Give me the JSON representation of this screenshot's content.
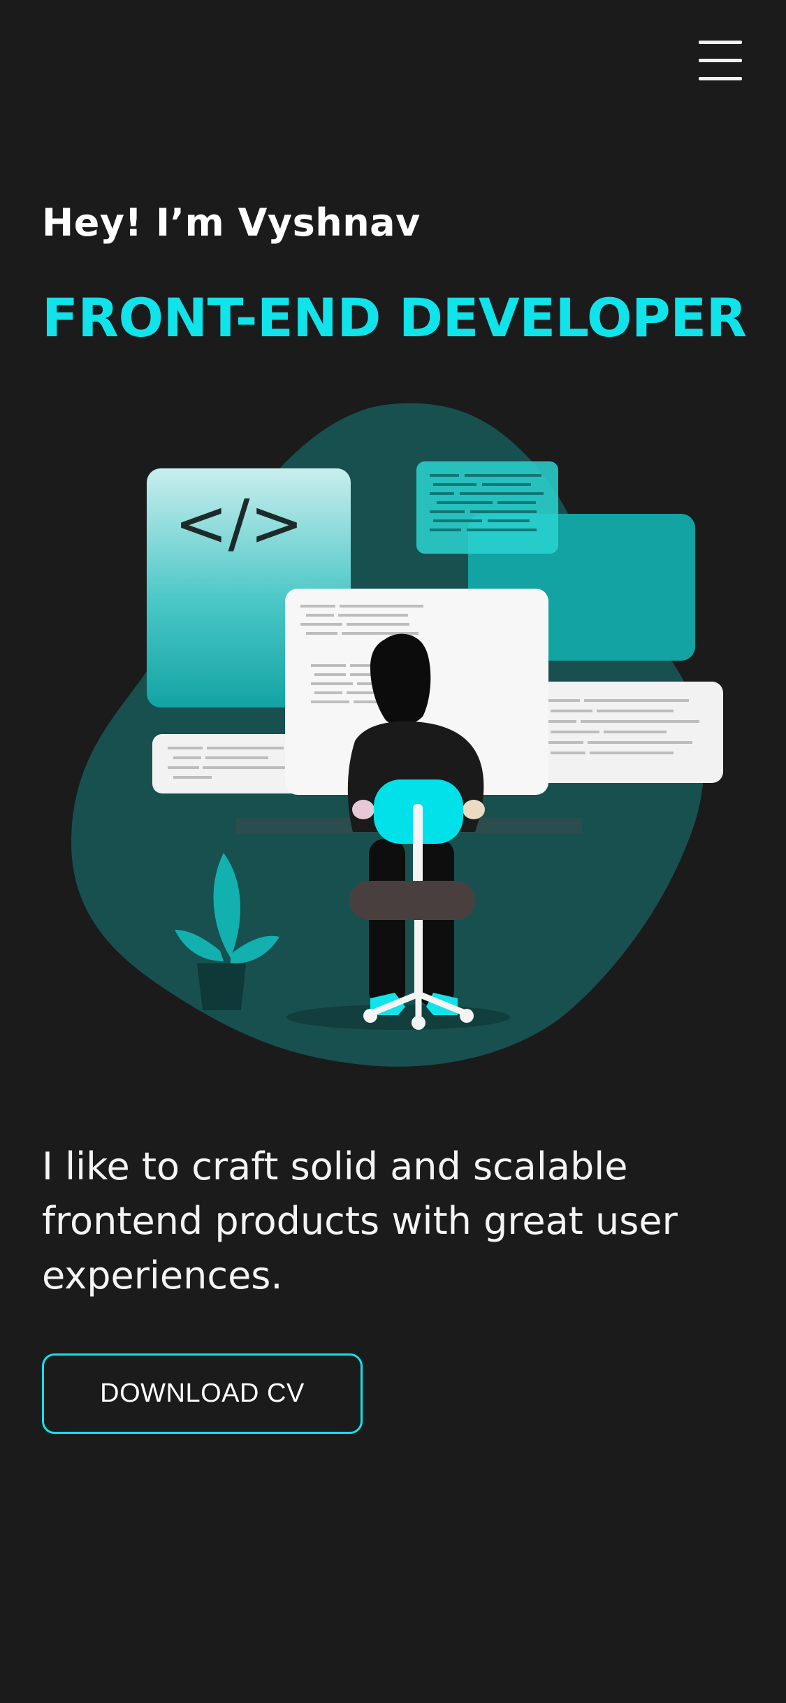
{
  "header": {
    "menu_icon": "hamburger-menu-icon"
  },
  "hero": {
    "greeting": "Hey! I’m Vyshnav",
    "role": "FRONT-END DEVELOPER",
    "code_symbol": "</>",
    "illustration": "developer-at-desk-illustration",
    "tagline": "I like to craft solid and scalable frontend products with great user experiences.",
    "cta_label": "DOWNLOAD CV"
  },
  "colors": {
    "background": "#1b1b1c",
    "accent": "#10e3ea",
    "blob": "#185050",
    "teal_panel": "#13a3a3",
    "text": "#ffffff"
  }
}
